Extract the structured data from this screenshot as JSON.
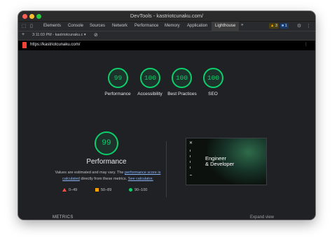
{
  "window": {
    "title": "DevTools - kastriotcunaku.com/"
  },
  "devtools": {
    "tabs": [
      "Elements",
      "Console",
      "Sources",
      "Network",
      "Performance",
      "Memory",
      "Application",
      "Lighthouse"
    ],
    "active_tab": "Lighthouse",
    "more_tabs": "»",
    "warnings_count": "3",
    "messages_count": "1"
  },
  "report_toolbar": {
    "add": "+",
    "run_selector": "3:11:03 PM - kastriotcunaku.c ▾",
    "clear": "⊘"
  },
  "url_bar": {
    "url": "https://kastriotcunaku.com/",
    "menu": "⋮"
  },
  "scores": [
    {
      "label": "Performance",
      "value": "99"
    },
    {
      "label": "Accessibility",
      "value": "100"
    },
    {
      "label": "Best Practices",
      "value": "100"
    },
    {
      "label": "SEO",
      "value": "100"
    }
  ],
  "performance": {
    "score": "99",
    "title": "Performance",
    "desc_prefix": "Values are estimated and may vary. The ",
    "desc_link1": "performance score is calculated",
    "desc_middle": " directly from these metrics. ",
    "desc_link2": "See calculator."
  },
  "legend": [
    {
      "range": "0–49",
      "icon": "fail-triangle-icon"
    },
    {
      "range": "50–89",
      "icon": "average-square-icon"
    },
    {
      "range": "90–100",
      "icon": "pass-circle-icon"
    }
  ],
  "screenshot": {
    "line1": "Engineer",
    "line2": "& Developer"
  },
  "metrics": {
    "heading": "METRICS",
    "expand": "Expand view"
  },
  "colors": {
    "pass": "#0cce6b",
    "average": "#ffa400",
    "fail": "#ff4e42",
    "link": "#8ab4f8",
    "background": "#202124"
  }
}
